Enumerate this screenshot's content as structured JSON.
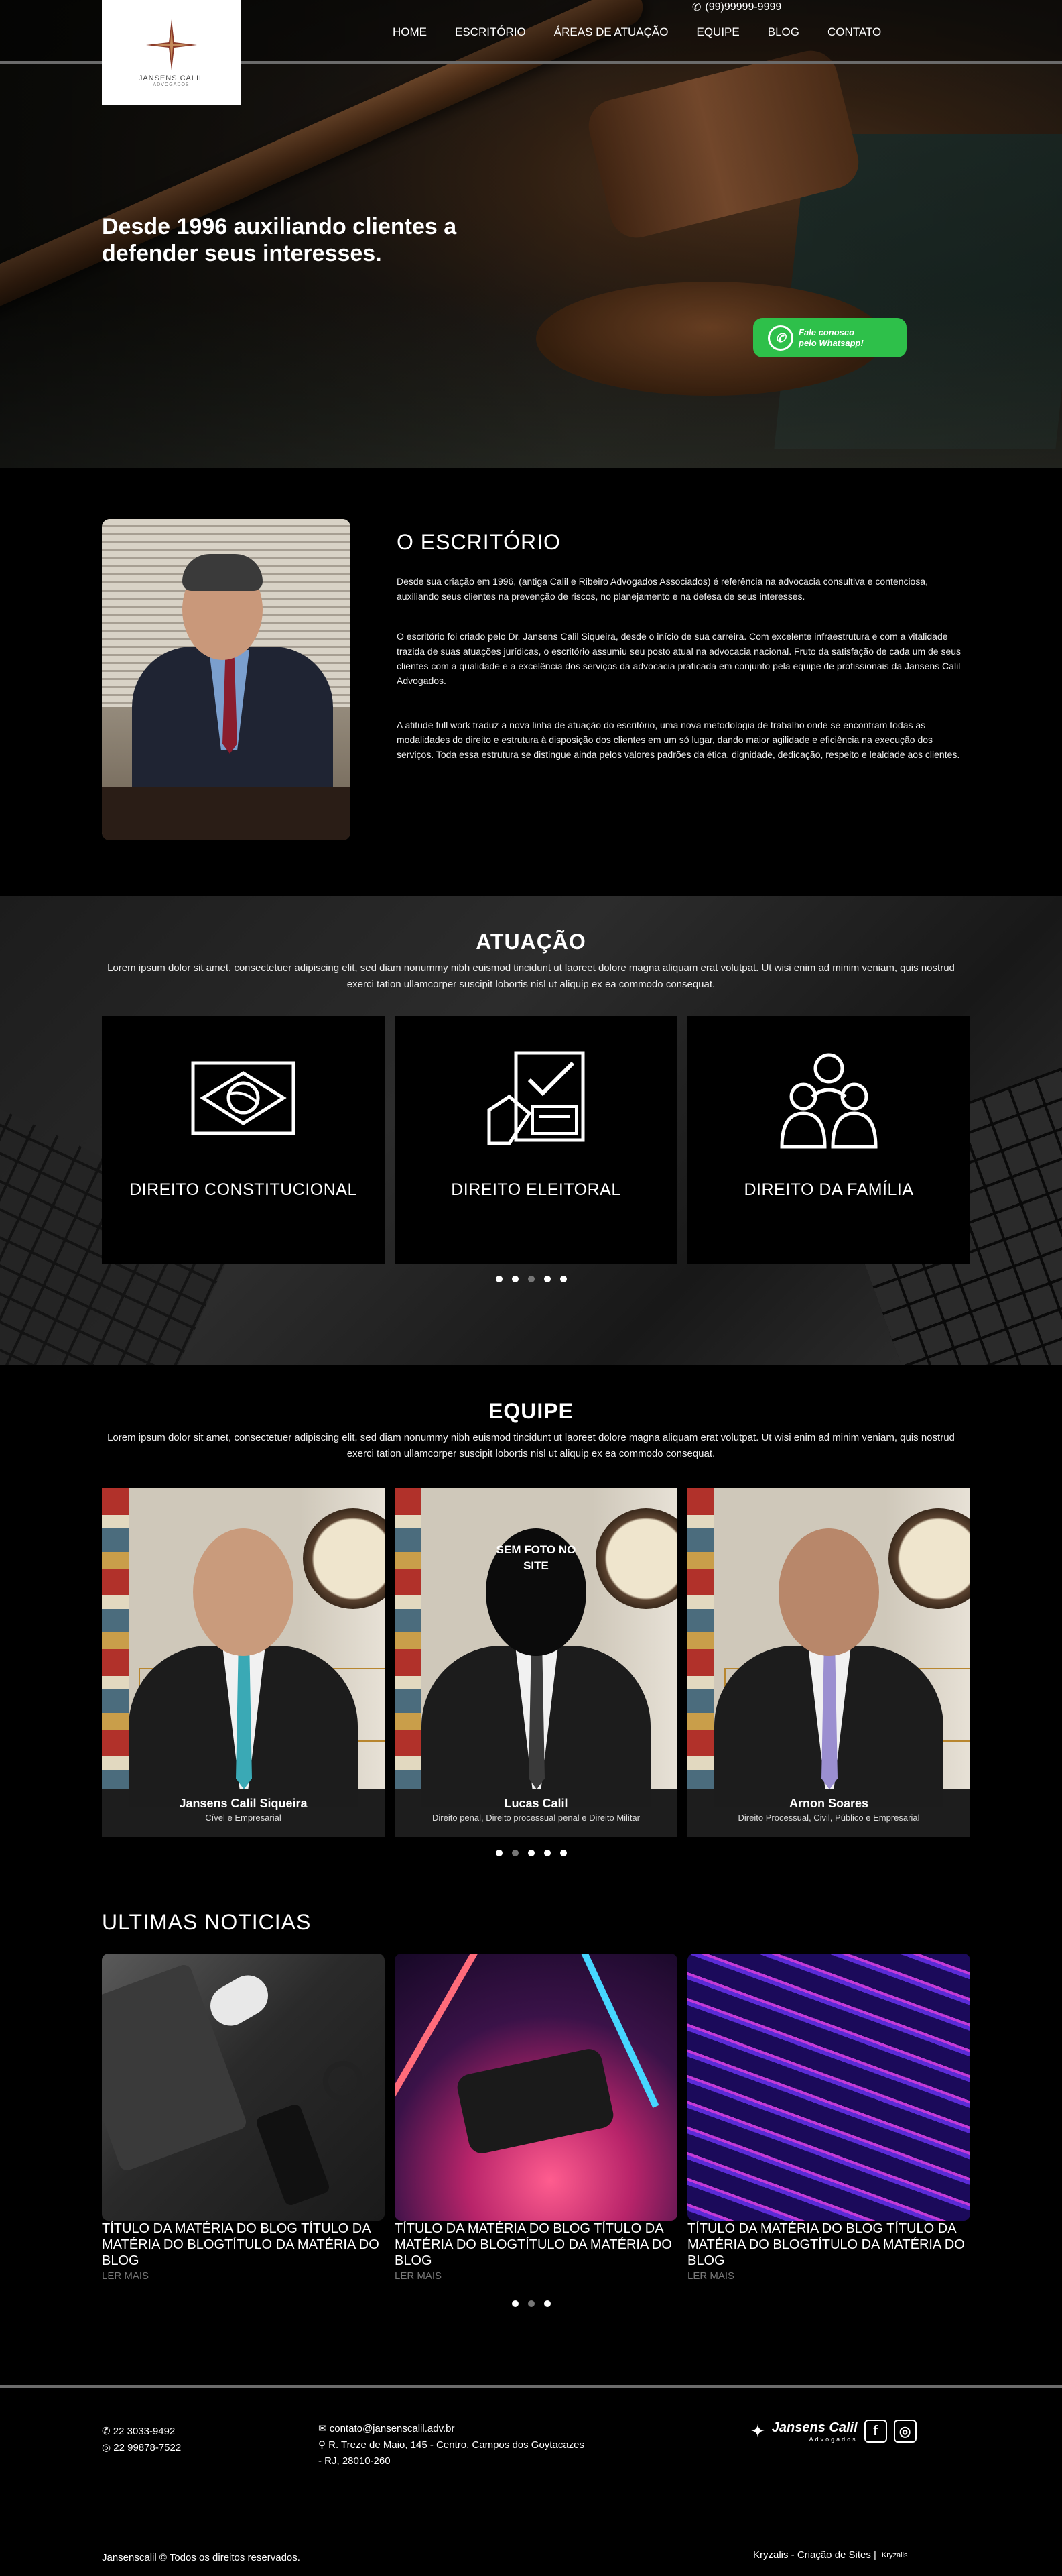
{
  "header": {
    "phone": "(99)99999-9999",
    "logo_name": "JANSENS CALIL",
    "logo_sub": "ADVOGADOS",
    "nav": [
      "HOME",
      "ESCRITÓRIO",
      "ÁREAS DE ATUAÇÃO",
      "EQUIPE",
      "BLOG",
      "CONTATO"
    ]
  },
  "hero": {
    "title": "Desde 1996 auxiliando clientes a defender seus interesses.",
    "whatsapp_line1": "Fale conosco",
    "whatsapp_line2": "pelo Whatsapp!"
  },
  "escritorio": {
    "title": "O ESCRITÓRIO",
    "p1": "Desde sua criação em 1996, (antiga Calil e Ribeiro Advogados Associados) é referência na advocacia consultiva e contenciosa, auxiliando seus clientes na prevenção de riscos, no planejamento e na defesa de seus interesses.",
    "p2": "O escritório foi criado pelo Dr. Jansens Calil Siqueira, desde o início de sua carreira. Com excelente infraestrutura e com a vitalidade trazida de suas atuações jurídicas, o escritório assumiu seu posto atual na advocacia nacional. Fruto da satisfação de cada um de seus clientes com a qualidade e a excelência dos serviços da advocacia praticada em conjunto pela equipe de profissionais da Jansens Calil Advogados.",
    "p3": "A atitude full work traduz a nova linha de atuação do escritório, uma nova metodologia de trabalho onde se encontram todas as modalidades do direito e estrutura à disposição dos clientes em um só lugar, dando maior agilidade e eficiência na execução dos serviços. Toda essa estrutura se distingue ainda pelos valores padrões da ética, dignidade, dedicação, respeito e lealdade aos clientes."
  },
  "atuacao": {
    "title": "ATUAÇÃO",
    "lead": "Lorem ipsum dolor sit amet, consectetuer adipiscing elit, sed diam nonummy nibh euismod tincidunt ut laoreet dolore magna aliquam erat volutpat. Ut wisi enim ad minim veniam, quis nostrud exerci tation ullamcorper suscipit lobortis nisl ut aliquip ex ea commodo consequat.",
    "cards": [
      {
        "label": "DIREITO CONSTITUCIONAL",
        "icon": "brazil-flag-icon"
      },
      {
        "label": "DIREITO ELEITORAL",
        "icon": "ballot-box-icon"
      },
      {
        "label": "DIREITO DA FAMÍLIA",
        "icon": "family-icon"
      }
    ]
  },
  "equipe": {
    "title": "EQUIPE",
    "lead": "Lorem ipsum dolor sit amet, consectetuer adipiscing elit, sed diam nonummy nibh euismod tincidunt ut laoreet dolore magna aliquam erat volutpat. Ut wisi enim ad minim veniam, quis nostrud exerci tation ullamcorper suscipit lobortis nisl ut aliquip ex ea commodo consequat.",
    "no_photo": "SEM FOTO NO SITE",
    "members": [
      {
        "name": "Jansens Calil Siqueira",
        "role": "Cível e Empresarial",
        "tie": "#3aa9b5"
      },
      {
        "name": "Lucas Calil",
        "role": "Direito penal, Direito processual penal e Direito Militar",
        "tie": "#3a3a3a"
      },
      {
        "name": "Arnon Soares",
        "role": "Direito Processual, Civil, Público e Empresarial",
        "tie": "#9b8fd0"
      }
    ]
  },
  "noticias": {
    "title": "ULTIMAS NOTICIAS",
    "posts": [
      {
        "title": "TÍTULO DA MATÉRIA DO BLOG TÍTULO DA MATÉRIA DO BLOGTÍTULO DA MATÉRIA DO BLOG",
        "more": "LER MAIS"
      },
      {
        "title": "TÍTULO DA MATÉRIA DO BLOG TÍTULO DA MATÉRIA DO BLOGTÍTULO DA MATÉRIA DO BLOG",
        "more": "LER MAIS"
      },
      {
        "title": "TÍTULO DA MATÉRIA DO BLOG TÍTULO DA MATÉRIA DO BLOGTÍTULO DA MATÉRIA DO BLOG",
        "more": "LER MAIS"
      }
    ]
  },
  "footer": {
    "phone1": "22 3033-9492",
    "phone2": "22 99878-7522",
    "email": "contato@jansenscalil.adv.br",
    "address": "R. Treze de Maio, 145 - Centro, Campos dos Goytacazes - RJ, 28010-260",
    "brand": "Jansens Calil",
    "brand_sub": "Advogados",
    "copyright": "Jansenscalil © Todos os direitos reservados.",
    "credit": "Kryzalis - Criação de Sites |",
    "credit_logo": "Kryzalis"
  },
  "colors": {
    "whatsapp": "#2ec04a",
    "accent_gold": "#b8862f",
    "background": "#000000"
  }
}
